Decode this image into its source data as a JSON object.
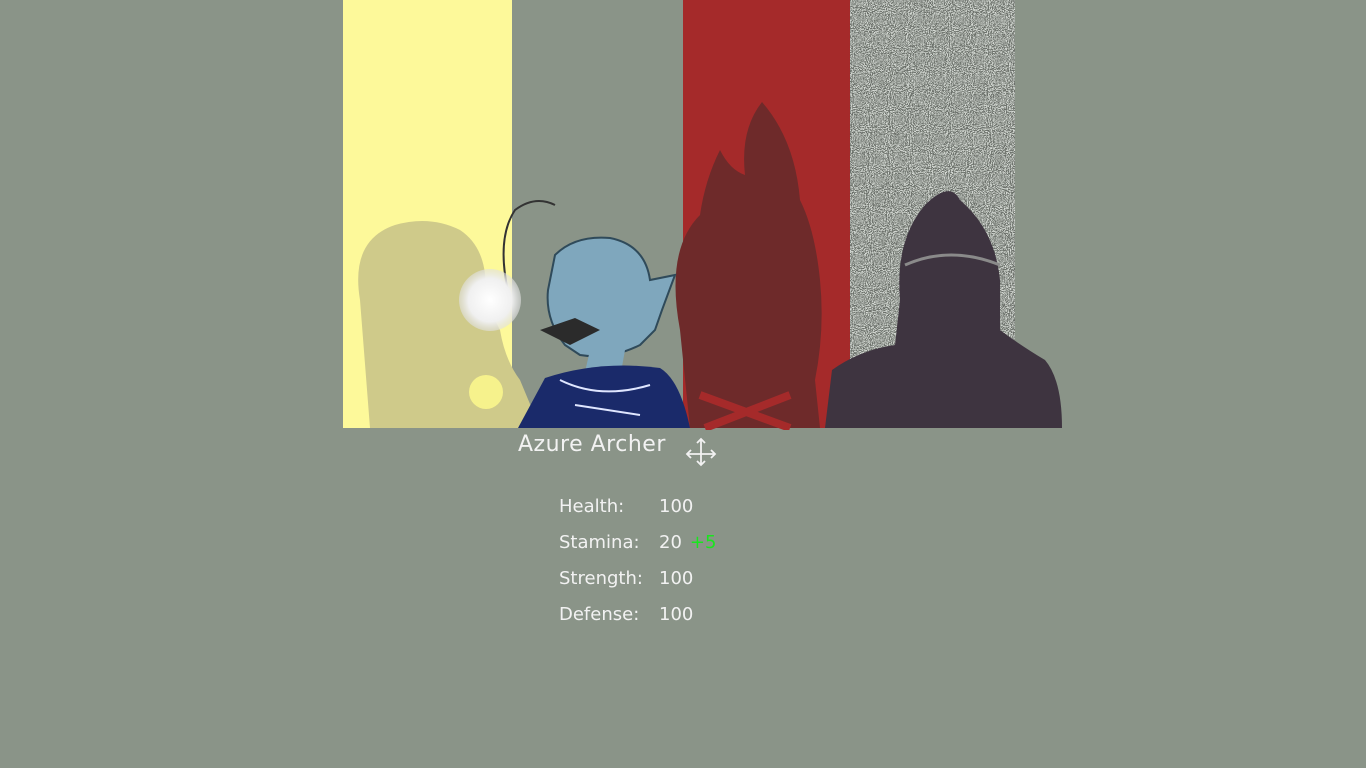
{
  "character": {
    "name": "Azure Archer"
  },
  "stats": [
    {
      "label": "Health:",
      "value": "100",
      "bonus": ""
    },
    {
      "label": "Stamina:",
      "value": "20",
      "bonus": "+5"
    },
    {
      "label": "Strength:",
      "value": "100",
      "bonus": ""
    },
    {
      "label": "Defense:",
      "value": "100",
      "bonus": ""
    }
  ],
  "colors": {
    "background": "#8a9488",
    "yellow_panel": "#fdf99a",
    "red_panel": "#a52a2a",
    "static_panel": "#2a2a2a",
    "text": "#f2f2f2",
    "bonus": "#19e61e"
  },
  "icons": {
    "move_cursor": "move-arrows-icon"
  }
}
